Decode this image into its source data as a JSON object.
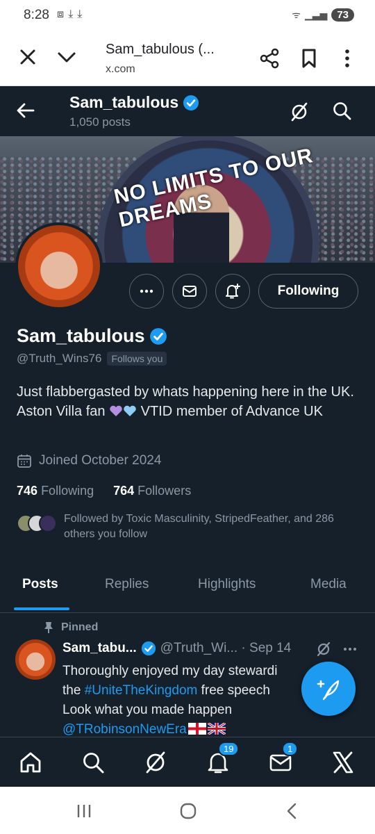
{
  "status_bar": {
    "time": "8:28",
    "battery": "73"
  },
  "browser": {
    "title": "Sam_tabulous (...",
    "url": "x.com"
  },
  "top_nav": {
    "name": "Sam_tabulous",
    "posts": "1,050 posts"
  },
  "banner": {
    "text": "NO LIMITS TO OUR DREAMS"
  },
  "profile": {
    "follow_button": "Following",
    "name": "Sam_tabulous",
    "handle": "@Truth_Wins76",
    "follows_you": "Follows you",
    "bio_part1": "Just flabbergasted by whats happening here in the UK. Aston Villa fan ",
    "bio_part2": " VTID member of Advance UK",
    "joined": "Joined October 2024",
    "following_count": "746",
    "following_label": "Following",
    "followers_count": "764",
    "followers_label": "Followers",
    "followed_by": "Followed by Toxic Masculinity, StripedFeather, and 286 others you follow"
  },
  "tabs": [
    "Posts",
    "Replies",
    "Highlights",
    "Media"
  ],
  "pinned_post": {
    "pinned_label": "Pinned",
    "name": "Sam_tabu...",
    "handle_date": "@Truth_Wi... · Sep 14",
    "text_line1": "Thoroughly enjoyed my day stewardi",
    "text_the": "the ",
    "hashtag": "#UniteTheKingdom",
    "text_line2_rest": " free speech",
    "text_line3": "Look what you made happen",
    "mention": "@TRobinsonNewEra"
  },
  "bottom_nav": {
    "notifications_badge": "19",
    "messages_badge": "1"
  },
  "colors": {
    "background": "#15202b",
    "accent": "#1d9bf0",
    "muted": "#8b98a5"
  }
}
